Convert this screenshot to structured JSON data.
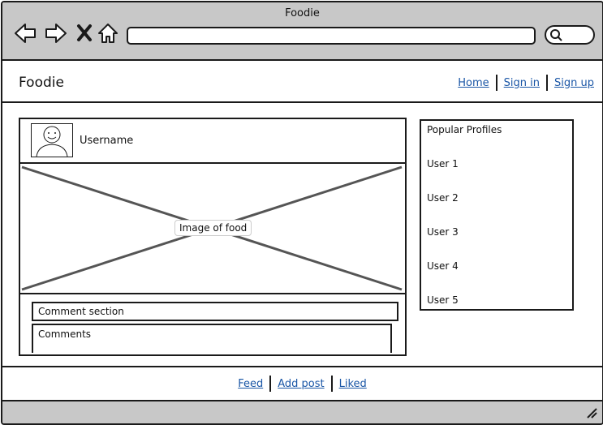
{
  "window": {
    "title": "Foodie"
  },
  "toolbar": {
    "icons": [
      "back-arrow-icon",
      "forward-arrow-icon",
      "close-icon",
      "home-icon",
      "search-icon"
    ]
  },
  "header": {
    "site_title": "Foodie",
    "links": [
      "Home",
      "Sign in",
      "Sign up"
    ]
  },
  "post": {
    "username": "Username",
    "image_label": "Image of food",
    "comment_section_label": "Comment section",
    "comments_label": "Comments"
  },
  "sidebar": {
    "title": "Popular Profiles",
    "users": [
      "User 1",
      "User 2",
      "User 3",
      "User 4",
      "User 5"
    ]
  },
  "footer": {
    "links": [
      "Feed",
      "Add post",
      "Liked"
    ]
  }
}
